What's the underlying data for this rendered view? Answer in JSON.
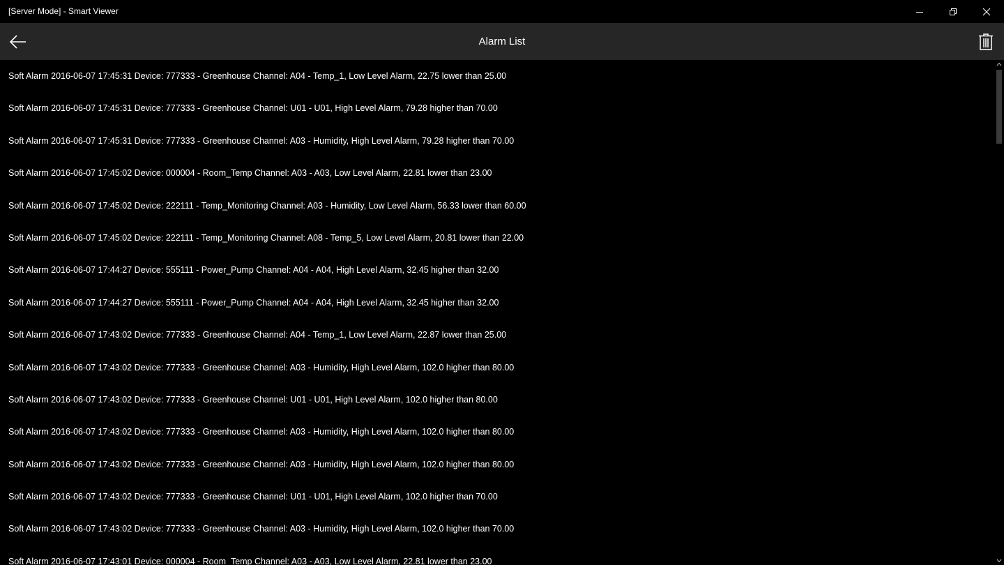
{
  "window": {
    "title": "[Server Mode] - Smart Viewer"
  },
  "appbar": {
    "title": "Alarm List",
    "back_icon": "arrow-left-icon",
    "delete_icon": "trash-icon"
  },
  "alarms": [
    "Soft Alarm 2016-06-07 17:45:31 Device: 777333 - Greenhouse Channel: A04 - Temp_1, Low Level Alarm, 22.75 lower than 25.00",
    "Soft Alarm 2016-06-07 17:45:31 Device: 777333 - Greenhouse Channel: U01 - U01, High Level Alarm, 79.28 higher than 70.00",
    "Soft Alarm 2016-06-07 17:45:31 Device: 777333 - Greenhouse Channel: A03 - Humidity, High Level Alarm, 79.28 higher than 70.00",
    "Soft Alarm 2016-06-07 17:45:02 Device: 000004 - Room_Temp Channel: A03 - A03, Low Level Alarm, 22.81 lower than 23.00",
    "Soft Alarm 2016-06-07 17:45:02 Device: 222111 - Temp_Monitoring Channel: A03 - Humidity, Low Level Alarm, 56.33 lower than 60.00",
    "Soft Alarm 2016-06-07 17:45:02 Device: 222111 - Temp_Monitoring Channel: A08 - Temp_5, Low Level Alarm, 20.81 lower than 22.00",
    "Soft Alarm 2016-06-07 17:44:27 Device: 555111 - Power_Pump Channel: A04 - A04, High Level Alarm, 32.45 higher than 32.00",
    "Soft Alarm 2016-06-07 17:44:27 Device: 555111 - Power_Pump Channel: A04 - A04, High Level Alarm, 32.45 higher than 32.00",
    "Soft Alarm 2016-06-07 17:43:02 Device: 777333 - Greenhouse Channel: A04 - Temp_1, Low Level Alarm, 22.87 lower than 25.00",
    "Soft Alarm 2016-06-07 17:43:02 Device: 777333 - Greenhouse Channel: A03 - Humidity, High Level Alarm, 102.0 higher than 80.00",
    "Soft Alarm 2016-06-07 17:43:02 Device: 777333 - Greenhouse Channel: U01 - U01, High Level Alarm, 102.0 higher than 80.00",
    "Soft Alarm 2016-06-07 17:43:02 Device: 777333 - Greenhouse Channel: A03 - Humidity, High Level Alarm, 102.0 higher than 80.00",
    "Soft Alarm 2016-06-07 17:43:02 Device: 777333 - Greenhouse Channel: A03 - Humidity, High Level Alarm, 102.0 higher than 80.00",
    "Soft Alarm 2016-06-07 17:43:02 Device: 777333 - Greenhouse Channel: U01 - U01, High Level Alarm, 102.0 higher than 70.00",
    "Soft Alarm 2016-06-07 17:43:02 Device: 777333 - Greenhouse Channel: A03 - Humidity, High Level Alarm, 102.0 higher than 70.00",
    "Soft Alarm 2016-06-07 17:43:01 Device: 000004 - Room_Temp Channel: A03 - A03, Low Level Alarm, 22.81 lower than 23.00"
  ],
  "colors": {
    "background": "#000000",
    "appbar": "#262626",
    "text": "#ffffff"
  }
}
